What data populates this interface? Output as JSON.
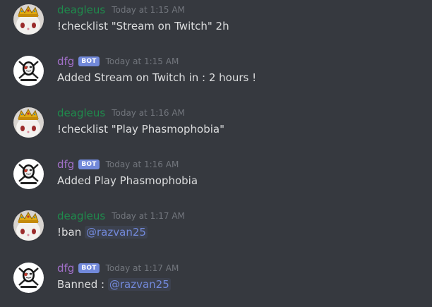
{
  "colors": {
    "background": "#36393f",
    "user_name": "#1f8b4c",
    "bot_name": "#a270c9",
    "bot_tag": "#7289da",
    "timestamp": "#72767d",
    "text": "#dcddde",
    "mention": "#7289da"
  },
  "messages": [
    {
      "author": "deagleus",
      "is_bot": false,
      "avatar": "cat-with-crown-avatar",
      "timestamp": "Today at 1:15 AM",
      "text": "!checklist \"Stream on Twitch\" 2h"
    },
    {
      "author": "dfg",
      "is_bot": true,
      "bot_label": "BOT",
      "avatar": "masked-pirate-avatar",
      "timestamp": "Today at 1:15 AM",
      "text": "Added Stream on Twitch in : 2 hours !"
    },
    {
      "author": "deagleus",
      "is_bot": false,
      "avatar": "cat-with-crown-avatar",
      "timestamp": "Today at 1:16 AM",
      "text": "!checklist \"Play Phasmophobia\""
    },
    {
      "author": "dfg",
      "is_bot": true,
      "bot_label": "BOT",
      "avatar": "masked-pirate-avatar",
      "timestamp": "Today at 1:16 AM",
      "text": "Added Play Phasmophobia"
    },
    {
      "author": "deagleus",
      "is_bot": false,
      "avatar": "cat-with-crown-avatar",
      "timestamp": "Today at 1:17 AM",
      "text_prefix": "!ban ",
      "mention": "@razvan25"
    },
    {
      "author": "dfg",
      "is_bot": true,
      "bot_label": "BOT",
      "avatar": "masked-pirate-avatar",
      "timestamp": "Today at 1:17 AM",
      "text_prefix": "Banned : ",
      "mention": "@razvan25"
    }
  ]
}
